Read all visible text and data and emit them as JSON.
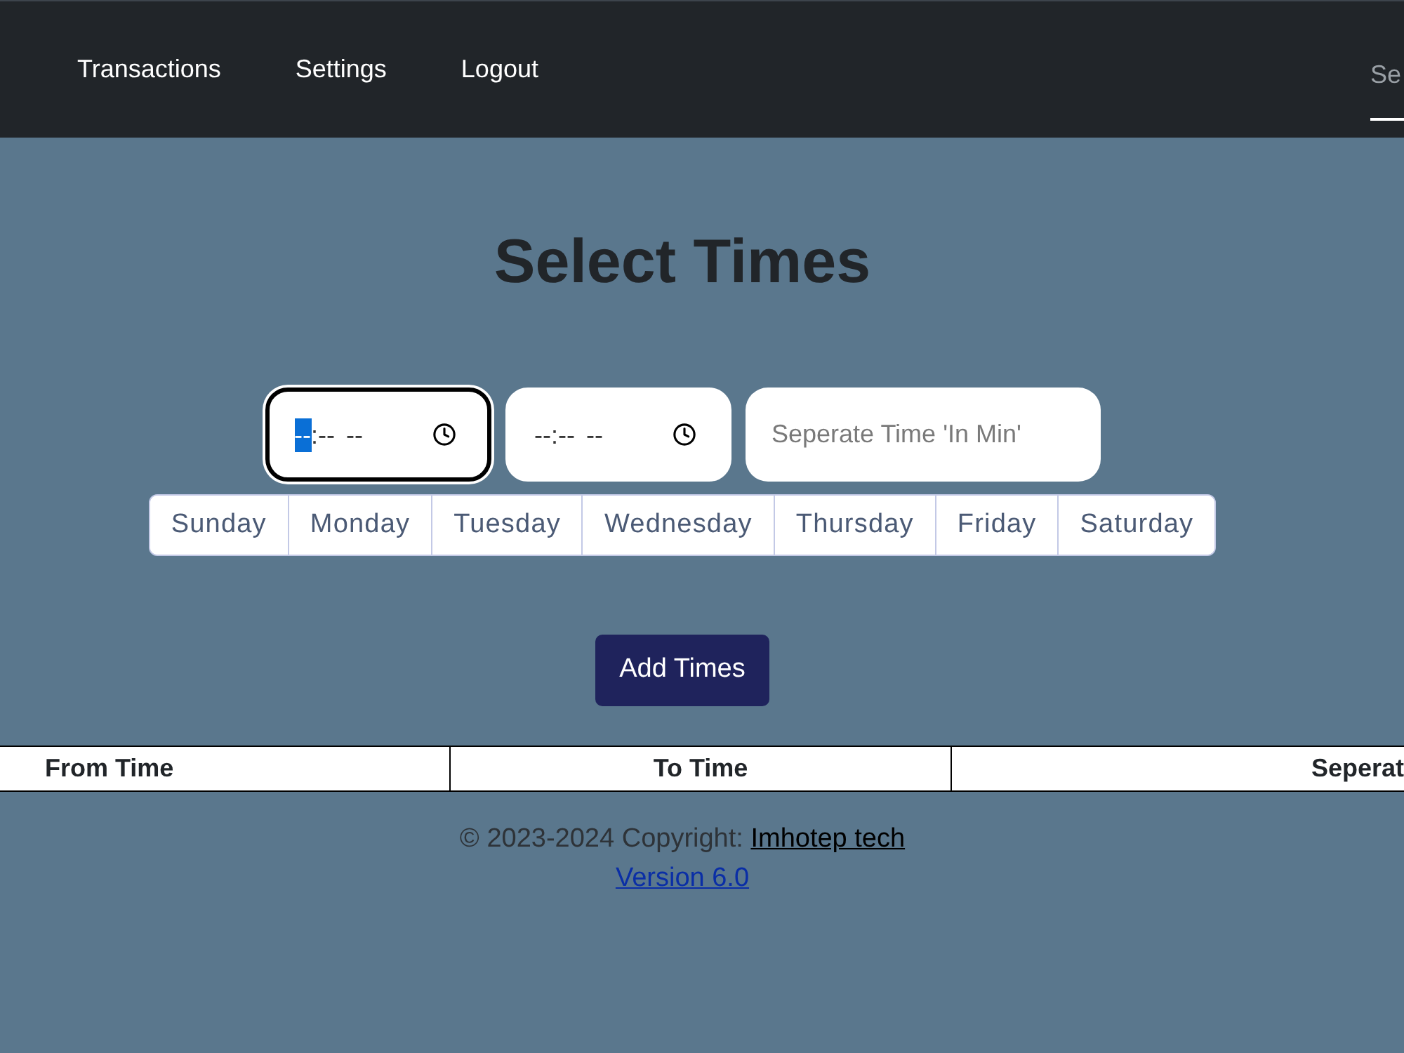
{
  "nav": {
    "links": [
      {
        "label": "Transactions"
      },
      {
        "label": "Settings"
      },
      {
        "label": "Logout"
      }
    ],
    "search": {
      "placeholder": "Se"
    }
  },
  "title": "Select Times",
  "time_fields": [
    {
      "focused": true,
      "segments": [
        {
          "text": "--",
          "selected": true
        },
        {
          "text": ":--",
          "selected": false
        },
        {
          "text": "--",
          "selected": false
        }
      ]
    },
    {
      "focused": false,
      "segments": [
        {
          "text": "--",
          "selected": false
        },
        {
          "text": ":--",
          "selected": false
        },
        {
          "text": "--",
          "selected": false
        }
      ]
    }
  ],
  "separate_field": {
    "placeholder": "Seperate Time 'In Min'"
  },
  "days": [
    {
      "label": "Sunday",
      "selected": false
    },
    {
      "label": "Monday",
      "selected": false
    },
    {
      "label": "Tuesday",
      "selected": false
    },
    {
      "label": "Wednesday",
      "selected": false
    },
    {
      "label": "Thursday",
      "selected": false
    },
    {
      "label": "Friday",
      "selected": false
    },
    {
      "label": "Saturday",
      "selected": false
    }
  ],
  "add_button": "Add Times",
  "table": {
    "columns": [
      "From Time",
      "To Time",
      "Seperat"
    ]
  },
  "footer": {
    "copyright": "© 2023-2024 Copyright:",
    "company_link": "Imhotep tech",
    "version_link": "Version 6.0"
  }
}
